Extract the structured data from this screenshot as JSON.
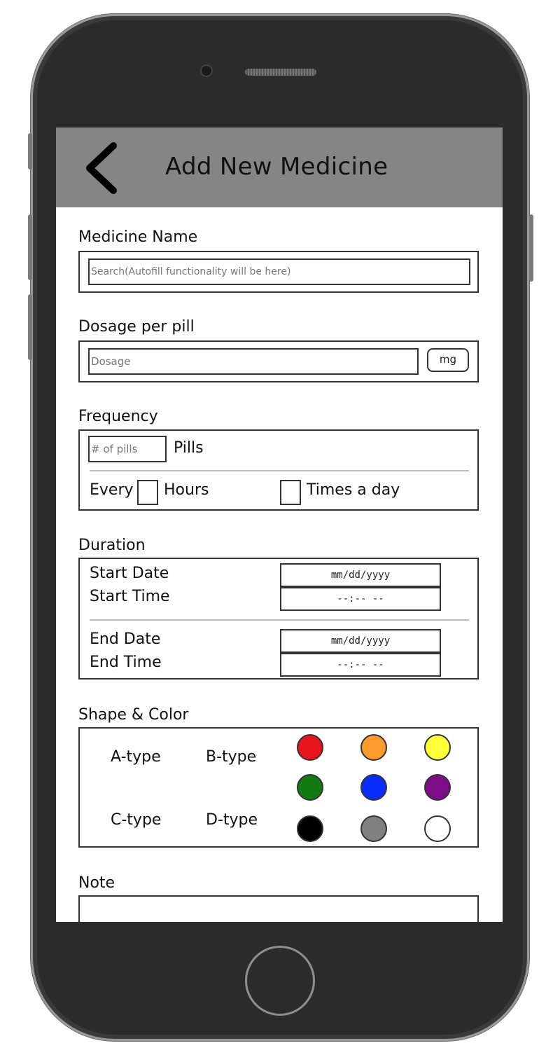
{
  "header": {
    "title": "Add New Medicine"
  },
  "medicine_name": {
    "label": "Medicine Name",
    "placeholder": "Search(Autofill functionality will be here)"
  },
  "dosage": {
    "label": "Dosage per pill",
    "placeholder": "Dosage",
    "unit": "mg"
  },
  "frequency": {
    "label": "Frequency",
    "pills_placeholder": "# of pills",
    "pills_label": "Pills",
    "every_label": "Every",
    "hours_label": "Hours",
    "times_label": "Times a day"
  },
  "duration": {
    "label": "Duration",
    "start_date_label": "Start Date",
    "start_time_label": "Start Time",
    "end_date_label": "End Date",
    "end_time_label": "End Time",
    "date_value": "mm/dd/yyyy",
    "time_value": "--:-- --"
  },
  "shape_color": {
    "label": "Shape & Color",
    "types": [
      "A-type",
      "B-type",
      "C-type",
      "D-type"
    ],
    "colors": [
      "#e8141c",
      "#fa9b2b",
      "#ffff3a",
      "#127a12",
      "#0a2cff",
      "#7d0d87",
      "#000000",
      "#808080",
      "#ffffff"
    ]
  },
  "note": {
    "label": "Note"
  }
}
